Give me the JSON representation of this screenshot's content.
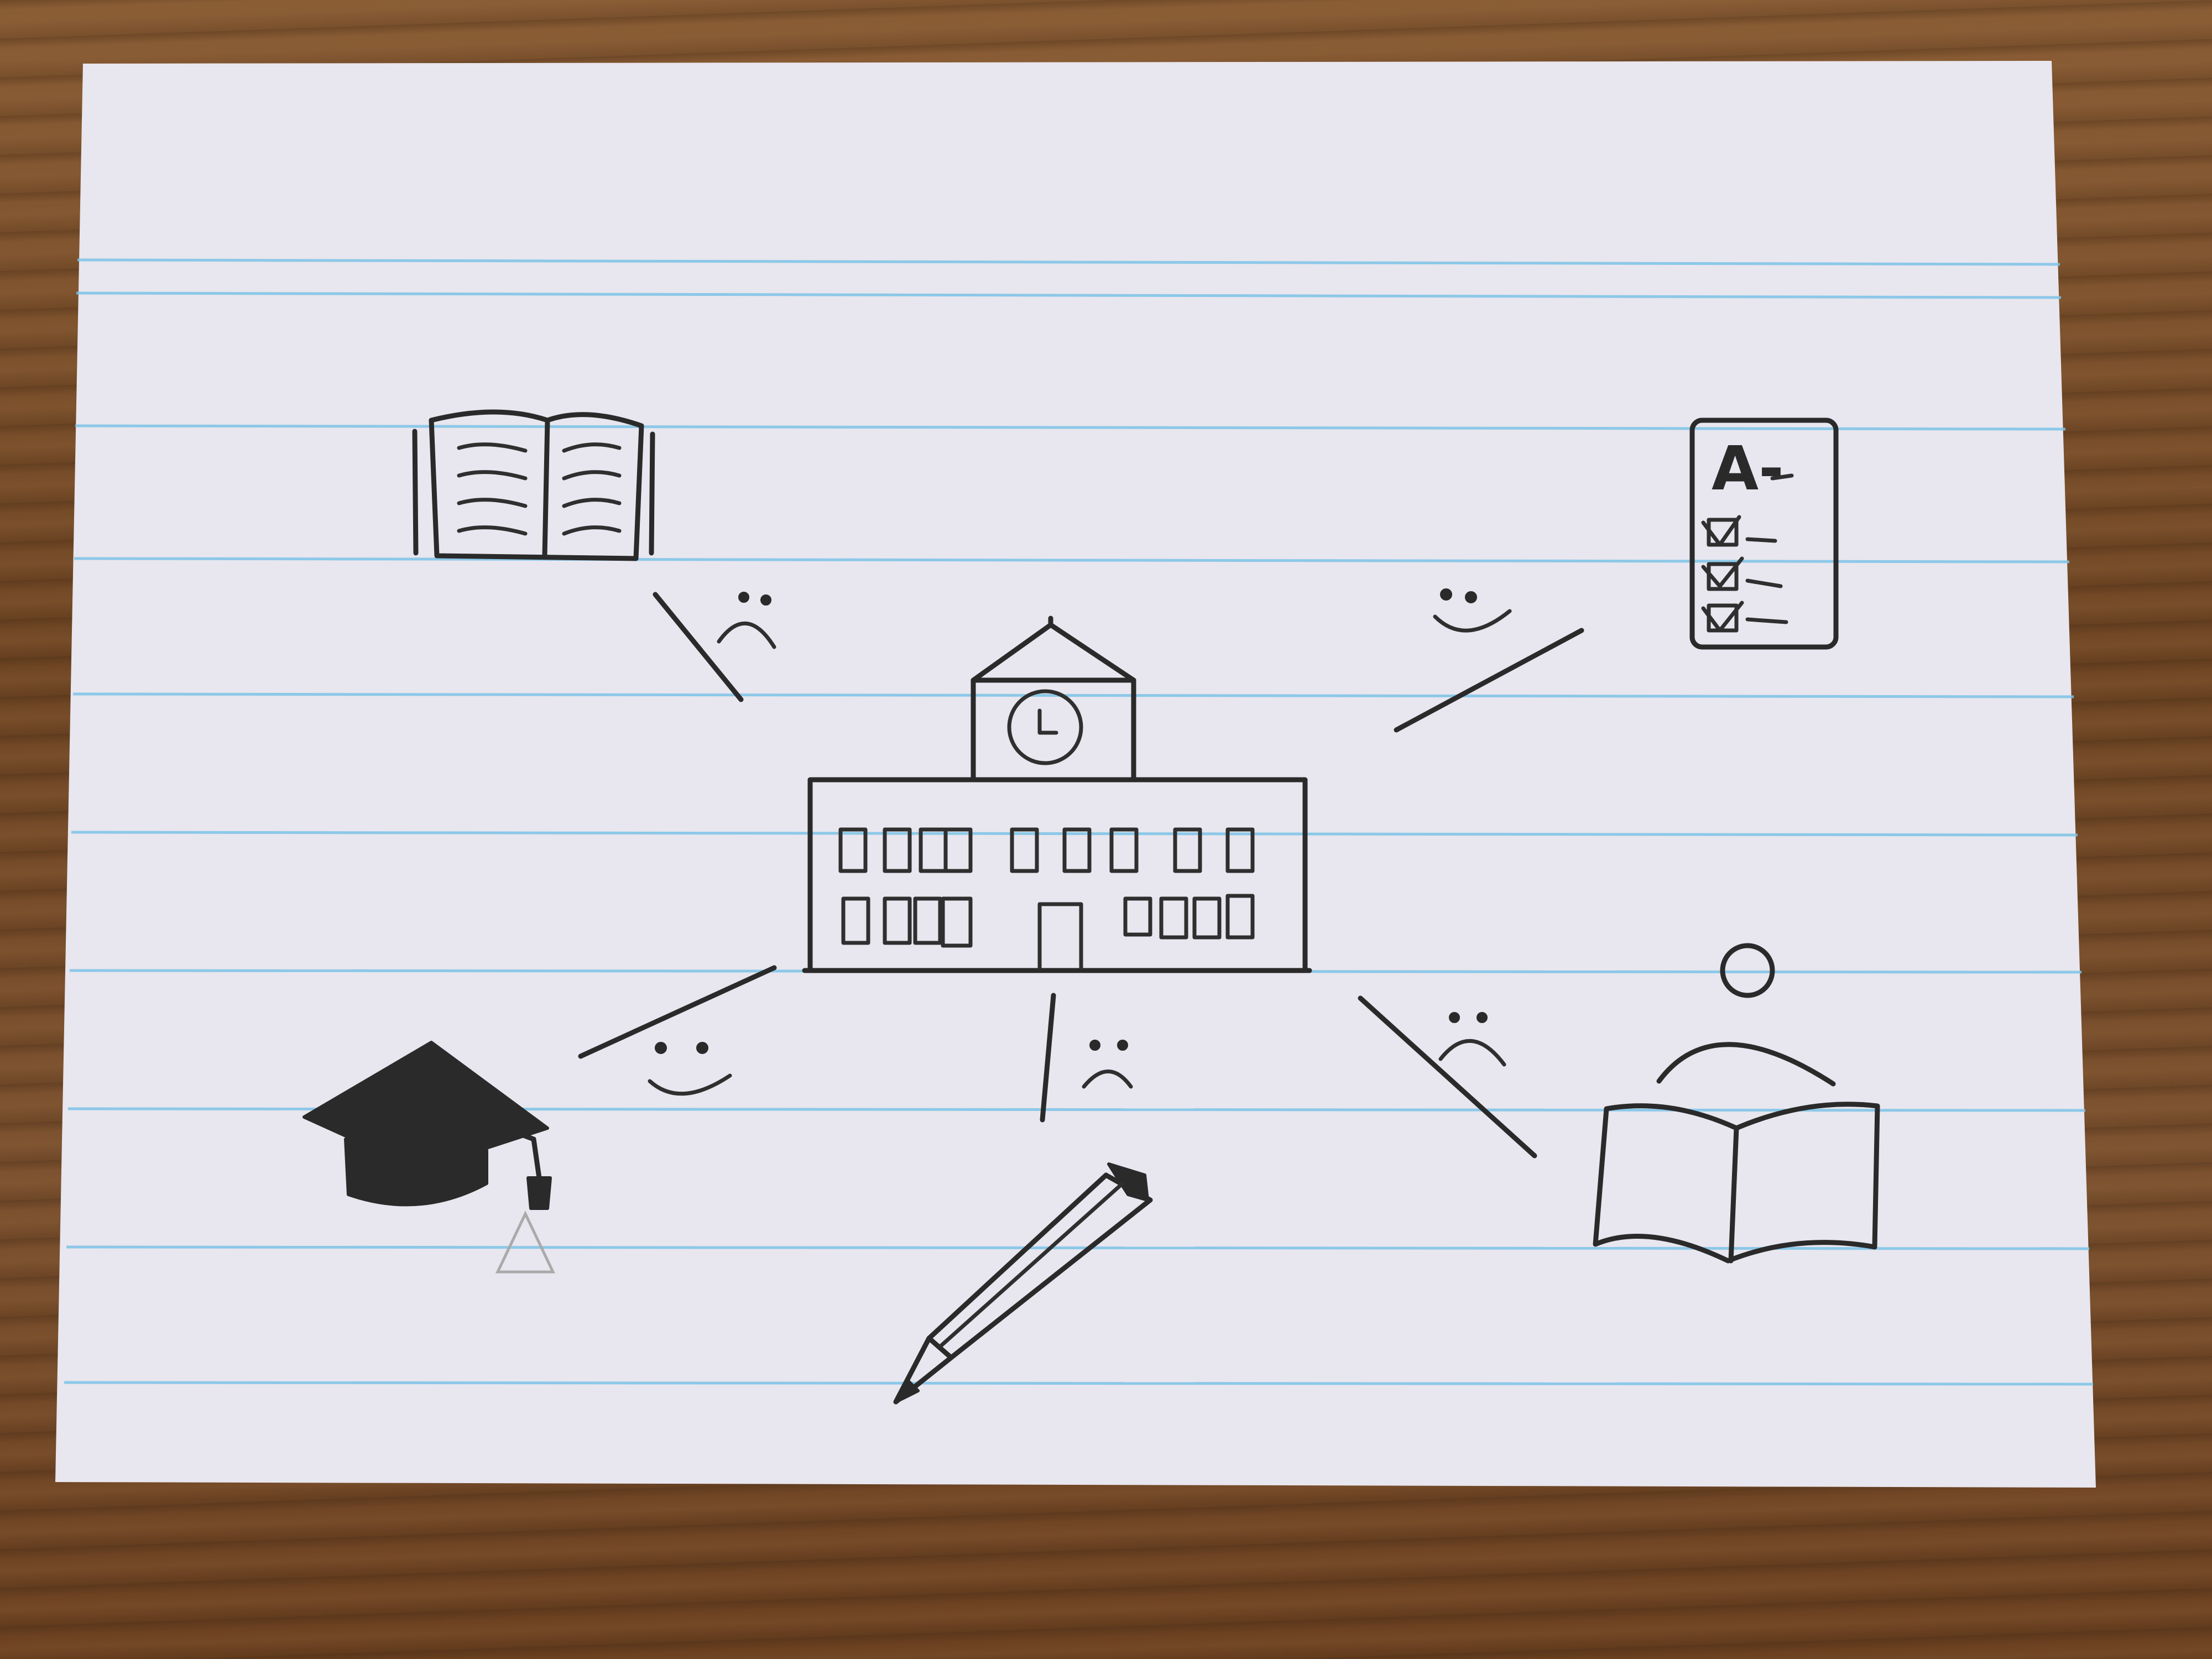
{
  "card": {
    "paper_color": "#e8e6ee",
    "rule_color": "#7cc3e8",
    "desk_color": "#7a4f2a"
  },
  "center": {
    "icon": "school-building-icon"
  },
  "nodes": [
    {
      "icon": "open-book-icon",
      "sentiment": "sad"
    },
    {
      "icon": "test-paper-icon",
      "grade": "A-",
      "sentiment": "happy"
    },
    {
      "icon": "graduation-cap-icon",
      "sentiment": "happy"
    },
    {
      "icon": "pencil-icon",
      "sentiment": "sad"
    },
    {
      "icon": "student-reading-icon",
      "sentiment": "sad"
    }
  ]
}
